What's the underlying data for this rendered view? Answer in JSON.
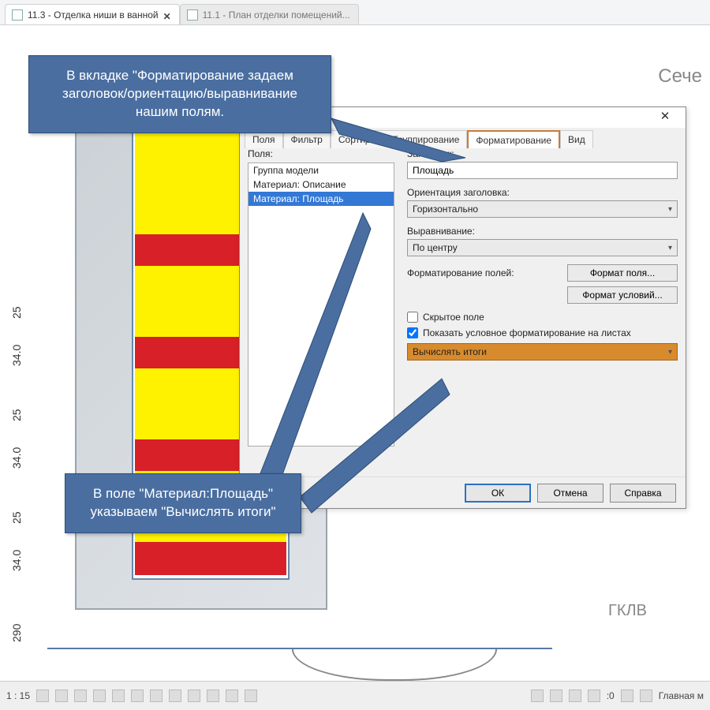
{
  "tabs": {
    "t0": {
      "title": "11.3 - Отделка ниши в ванной"
    },
    "t1": {
      "title": "11.1 - План отделки помещений..."
    }
  },
  "canvas": {
    "label_seche": "Сече",
    "label_gklv": "ГКЛВ",
    "dims": [
      "25",
      "34.0",
      "25",
      "34.0",
      "25",
      "34.0",
      "290"
    ]
  },
  "callouts": {
    "top": "В вкладке \"Форматирование задаем заголовок/ориентацию/выравнивание нашим полям.",
    "bottom": "В поле \"Материал:Площадь\" указываем \"Вычислять итоги\""
  },
  "dialog": {
    "tabs": {
      "polia": "Поля",
      "filter": "Фильтр",
      "sort": "Сортировка/Группирование",
      "format": "Форматирование",
      "vid": "Вид"
    },
    "left": {
      "label": "Поля:",
      "items": [
        "Группа модели",
        "Материал: Описание",
        "Материал: Площадь"
      ],
      "selected": 2
    },
    "right": {
      "heading_label": "Заголовок:",
      "heading_value": "Площадь",
      "orient_label": "Ориентация заголовка:",
      "orient_value": "Горизонтально",
      "align_label": "Выравнивание:",
      "align_value": "По центру",
      "format_label": "Форматирование полей:",
      "btn_format_field": "Формат поля...",
      "btn_format_cond": "Формат условий...",
      "cb_hidden": "Скрытое поле",
      "cb_cond": "Показать условное форматирование на листах",
      "totals_value": "Вычислять итоги"
    },
    "footer": {
      "ok": "ОК",
      "cancel": "Отмена",
      "help": "Справка"
    }
  },
  "status": {
    "scale": "1 : 15",
    "zero": ":0",
    "main": "Главная м"
  }
}
